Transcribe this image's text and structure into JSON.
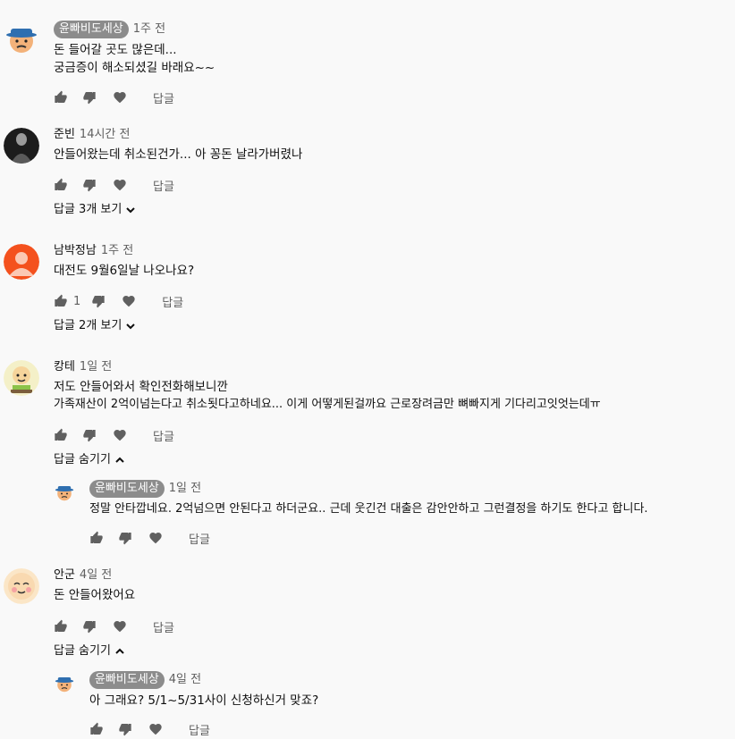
{
  "ui": {
    "reply_label": "답글"
  },
  "comments": [
    {
      "author": "윤빠비도세상",
      "time": "1주 전",
      "lines": [
        "돈 들어갈 곳도 많은데...",
        "궁금증이 해소되셨길 바래요~~"
      ],
      "likes": ""
    },
    {
      "author": "준빈",
      "time": "14시간 전",
      "lines": [
        "안들어왔는데 취소된건가... 아 꽁돈 날라가버렸나"
      ],
      "likes": "",
      "toggle": "답글 3개 보기"
    },
    {
      "author": "남박정남",
      "time": "1주 전",
      "lines": [
        "대전도 9월6일날 나오나요?"
      ],
      "likes": "1",
      "toggle": "답글 2개 보기"
    },
    {
      "author": "캉테",
      "time": "1일 전",
      "lines": [
        "저도 안들어와서 확인전화해보니깐",
        "가족재산이 2억이넘는다고 취소됫다고하네요... 이게 어떻게된걸까요 근로장려금만 뼈빠지게 기다리고잇엇는데ㅠ"
      ],
      "likes": "",
      "toggle": "답글 숨기기"
    },
    {
      "author": "윤빠비도세상",
      "time": "1일 전",
      "lines": [
        "정말 안타깝네요. 2억넘으면 안된다고 하더군요.. 근데 웃긴건 대출은 감안안하고 그런결정을 하기도 한다고 합니다."
      ],
      "likes": ""
    },
    {
      "author": "안군",
      "time": "4일 전",
      "lines": [
        "돈 안들어왔어요"
      ],
      "likes": "",
      "toggle": "답글 숨기기"
    },
    {
      "author": "윤빠비도세상",
      "time": "4일 전",
      "lines": [
        "아 그래요? 5/1~5/31사이 신청하신거 맞죠?"
      ],
      "likes": ""
    }
  ]
}
